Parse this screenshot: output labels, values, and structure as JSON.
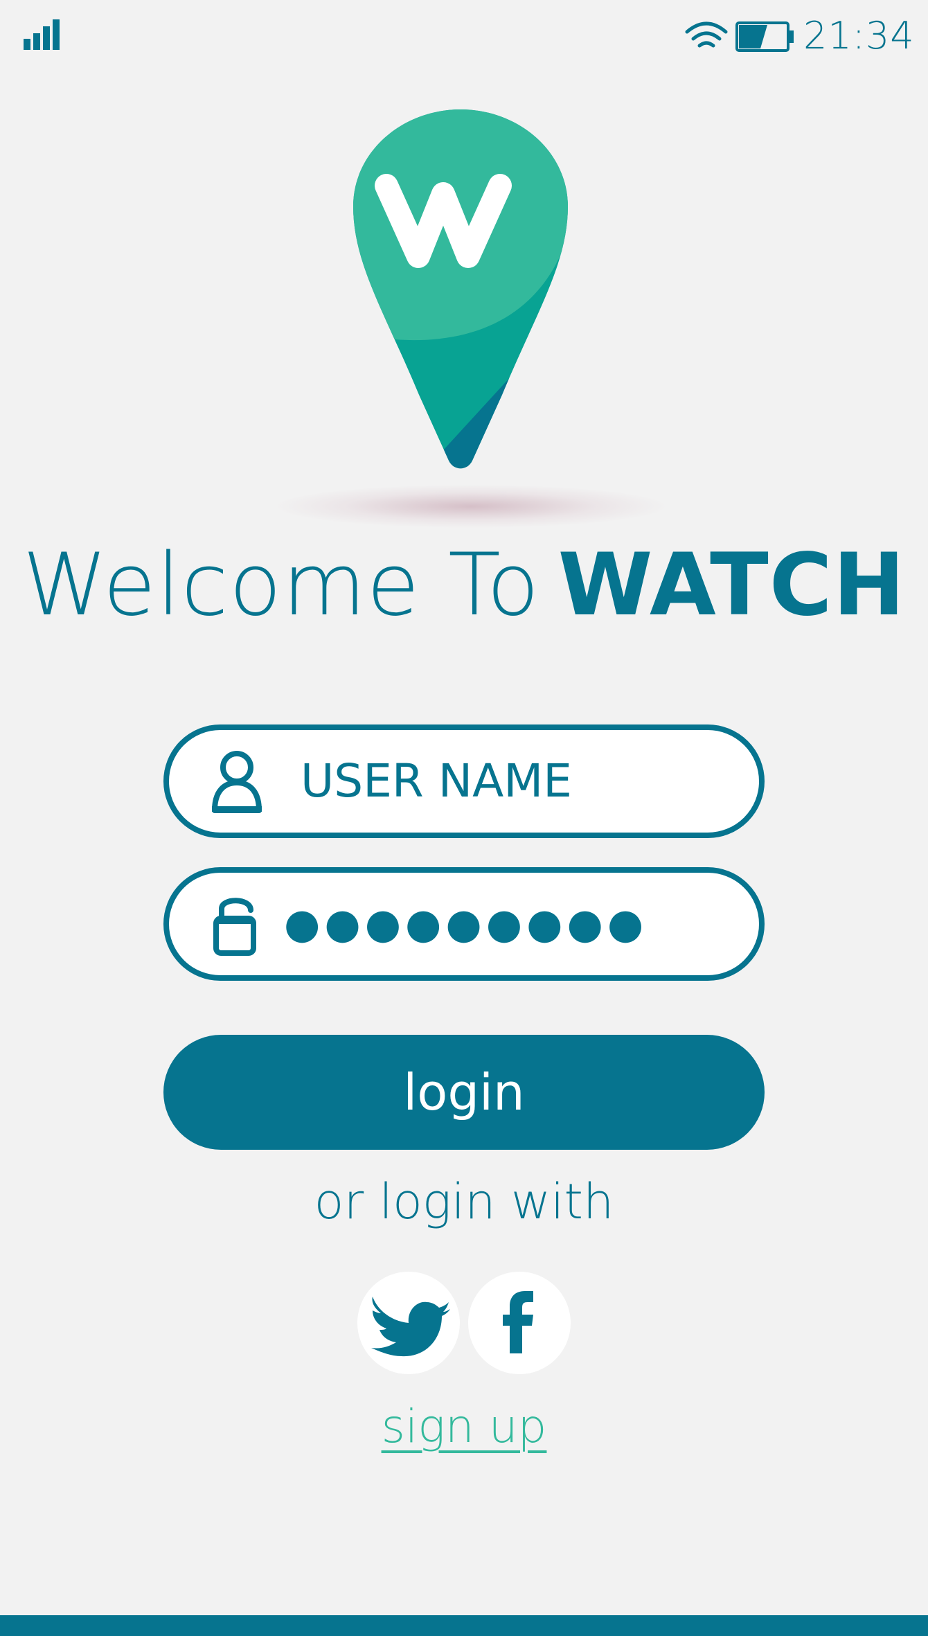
{
  "status_bar": {
    "time": "21:34",
    "signal_icon": "signal-bars-icon",
    "wifi_icon": "wifi-icon",
    "battery_icon": "battery-icon",
    "battery_level": 0.6
  },
  "logo": {
    "icon": "map-pin-logo-icon",
    "letter": "W"
  },
  "welcome": {
    "text": "Welcome To",
    "brand": "WATCH"
  },
  "form": {
    "username_placeholder": "USER NAME",
    "username_icon": "user-icon",
    "password_value": "●●●●●●●●●",
    "password_icon": "unlock-icon"
  },
  "login_button": "login",
  "or_login_with": "or login with",
  "social": [
    {
      "icon": "twitter-icon"
    },
    {
      "icon": "facebook-icon"
    }
  ],
  "signup_link": "sign up",
  "colors": {
    "primary": "#06748f",
    "accent_green": "#33b99c",
    "teal_dark": "#08a393",
    "background": "#f2f2f2"
  }
}
